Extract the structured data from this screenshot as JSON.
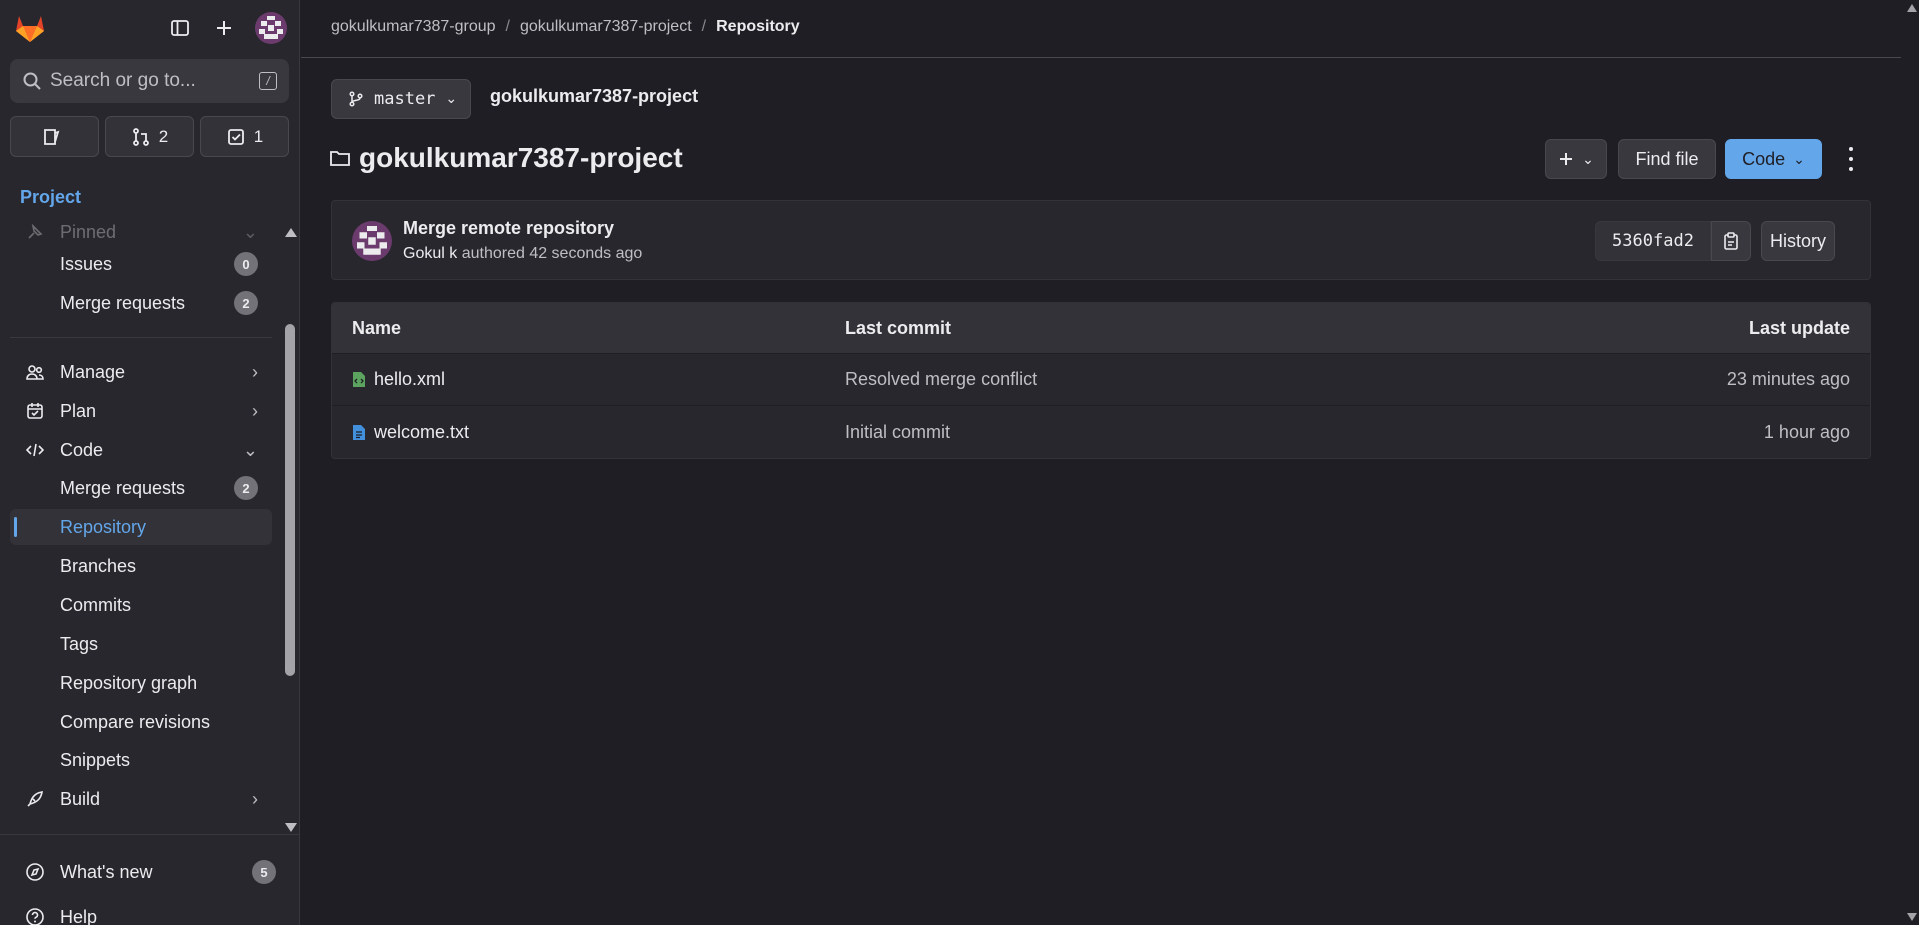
{
  "sidebar": {
    "search_placeholder": "Search or go to...",
    "search_shortcut": "/",
    "counters": [
      {
        "icon": "todo-icon",
        "count": ""
      },
      {
        "icon": "merge-request-icon",
        "count": "2"
      },
      {
        "icon": "issue-check-icon",
        "count": "1"
      }
    ],
    "context_label": "Project",
    "pinned_label": "Pinned",
    "pinned_items": [
      {
        "label": "Issues",
        "badge": "0"
      },
      {
        "label": "Merge requests",
        "badge": "2"
      }
    ],
    "sections": {
      "manage": "Manage",
      "plan": "Plan",
      "code": "Code",
      "build": "Build"
    },
    "code_items": [
      {
        "label": "Merge requests",
        "badge": "2"
      },
      {
        "label": "Repository"
      },
      {
        "label": "Branches"
      },
      {
        "label": "Commits"
      },
      {
        "label": "Tags"
      },
      {
        "label": "Repository graph"
      },
      {
        "label": "Compare revisions"
      },
      {
        "label": "Snippets"
      }
    ],
    "whats_new": {
      "label": "What's new",
      "badge": "5"
    },
    "help": "Help"
  },
  "breadcrumb": {
    "group": "gokulkumar7387-group",
    "project": "gokulkumar7387-project",
    "current": "Repository"
  },
  "repo": {
    "branch": "master",
    "project_name": "gokulkumar7387-project",
    "title": "gokulkumar7387-project",
    "find_file": "Find file",
    "code_button": "Code"
  },
  "commit": {
    "title": "Merge remote repository",
    "author": "Gokul k",
    "meta": "authored 42 seconds ago",
    "sha": "5360fad2",
    "history": "History"
  },
  "table": {
    "headers": {
      "name": "Name",
      "last_commit": "Last commit",
      "last_update": "Last update"
    },
    "rows": [
      {
        "name": "hello.xml",
        "icon": "xml-file-icon",
        "commit": "Resolved merge conflict",
        "updated": "23 minutes ago"
      },
      {
        "name": "welcome.txt",
        "icon": "text-file-icon",
        "commit": "Initial commit",
        "updated": "1 hour ago"
      }
    ]
  },
  "colors": {
    "accent": "#63a6e9",
    "background": "#1f1e24",
    "sidebar": "#28272d",
    "logo_orange": "#e24329"
  }
}
